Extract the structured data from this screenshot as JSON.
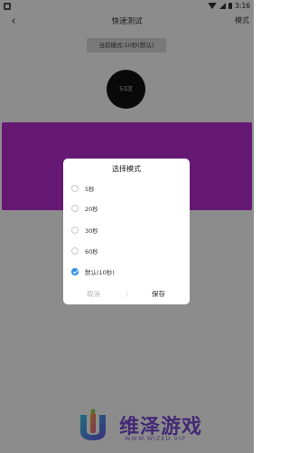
{
  "status_bar": {
    "time": "3:16",
    "icons": [
      "notification-icon",
      "wifi-icon",
      "signal-icon",
      "battery-icon"
    ]
  },
  "app_bar": {
    "back_icon": "‹",
    "title": "快速测试",
    "action": "模式"
  },
  "main": {
    "current_mode": "当前模式:10秒(默认)",
    "counter": "53次",
    "tap_area_color": "#b92fd0"
  },
  "dialog": {
    "title": "选择模式",
    "options": [
      {
        "label": "5秒",
        "checked": false
      },
      {
        "label": "20秒",
        "checked": false
      },
      {
        "label": "30秒",
        "checked": false
      },
      {
        "label": "60秒",
        "checked": false
      },
      {
        "label": "默认(10秒)",
        "checked": true
      }
    ],
    "cancel_label": "取消",
    "save_label": "保存"
  },
  "watermark": {
    "title": "维泽游戏",
    "url": "WWW.WIZED.VIP"
  },
  "colors": {
    "accent": "#2e8be6",
    "tap_area": "#b92fd0",
    "watermark": "#7a4bd6"
  }
}
